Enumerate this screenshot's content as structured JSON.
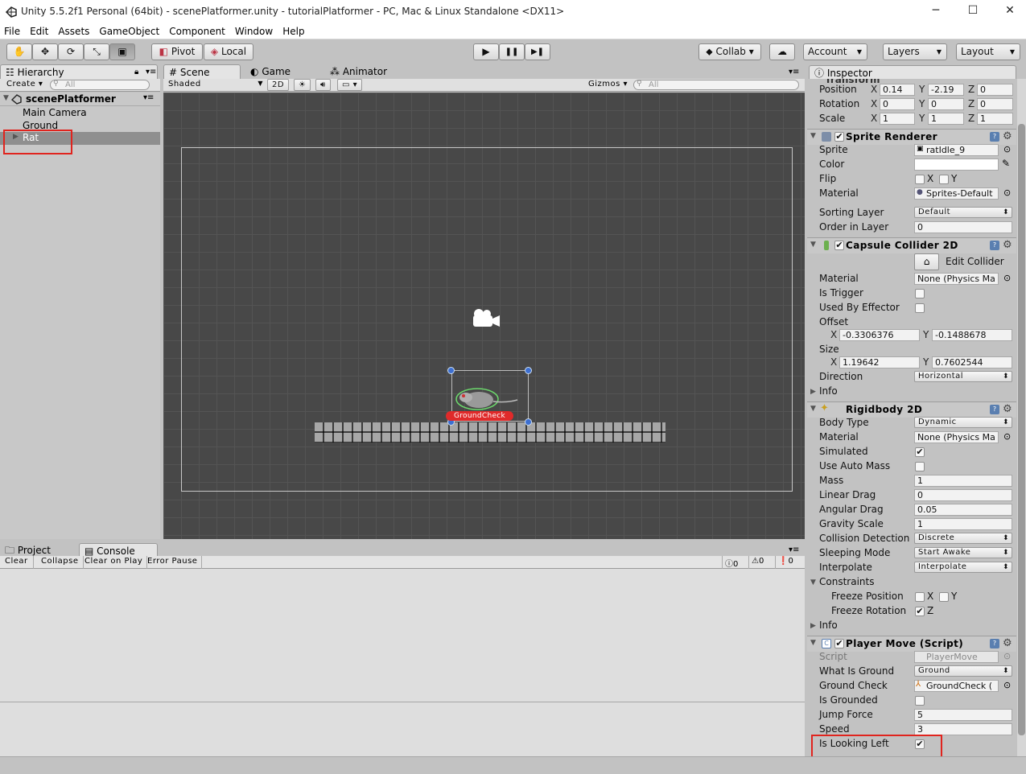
{
  "window": {
    "title": "Unity 5.5.2f1 Personal (64bit) - scenePlatformer.unity - tutorialPlatformer - PC, Mac & Linux Standalone <DX11>",
    "minimize": "─",
    "maximize": "☐",
    "close": "✕"
  },
  "menu": [
    "File",
    "Edit",
    "Assets",
    "GameObject",
    "Component",
    "Window",
    "Help"
  ],
  "toolbar": {
    "pivot": "Pivot",
    "local": "Local",
    "collab": "Collab ▾",
    "account": "Account",
    "layers": "Layers",
    "layout": "Layout",
    "play": "▶",
    "pause": "❚❚",
    "step": "▶❚"
  },
  "tabs": {
    "hierarchy": "Hierarchy",
    "scene": "Scene",
    "game": "Game",
    "animator": "Animator",
    "inspector": "Inspector",
    "project": "Project",
    "console": "Console"
  },
  "hierarchy": {
    "create": "Create ▾",
    "search_placeholder": "All",
    "scene": "scenePlatformer",
    "items": [
      "Main Camera",
      "Ground",
      "Rat"
    ],
    "selected": "Rat"
  },
  "scene_toolbar": {
    "shaded": "Shaded",
    "mode_2d": "2D",
    "gizmos": "Gizmos ▾",
    "search_placeholder": "All"
  },
  "scene": {
    "ground_check_label": "GroundCheck"
  },
  "console": {
    "clear": "Clear",
    "collapse": "Collapse",
    "clear_on_play": "Clear on Play",
    "error_pause": "Error Pause",
    "log_count": "0",
    "warn_count": "0",
    "error_count": "0"
  },
  "inspector": {
    "transform": {
      "title": "Transform",
      "position_label": "Position",
      "rotation_label": "Rotation",
      "scale_label": "Scale",
      "position": [
        "0.14",
        "-2.19",
        "0"
      ],
      "rotation": [
        "0",
        "0",
        "0"
      ],
      "scale": [
        "1",
        "1",
        "1"
      ],
      "x": "X",
      "y": "Y",
      "z": "Z"
    },
    "sprite_renderer": {
      "title": "Sprite Renderer",
      "enabled": "✔",
      "sprite_label": "Sprite",
      "sprite": "ratIdle_9",
      "color_label": "Color",
      "flip_label": "Flip",
      "flip_x": "X",
      "flip_y": "Y",
      "material_label": "Material",
      "material": "Sprites-Default",
      "sorting_layer_label": "Sorting Layer",
      "sorting_layer": "Default",
      "order_label": "Order in Layer",
      "order": "0"
    },
    "capsule_collider": {
      "title": "Capsule Collider 2D",
      "enabled": "✔",
      "edit_collider": "Edit Collider",
      "material_label": "Material",
      "material": "None (Physics Ma",
      "is_trigger_label": "Is Trigger",
      "used_by_effector_label": "Used By Effector",
      "offset_label": "Offset",
      "offset": [
        "-0.3306376",
        "-0.1488678"
      ],
      "size_label": "Size",
      "size": [
        "1.19642",
        "0.7602544"
      ],
      "direction_label": "Direction",
      "direction": "Horizontal",
      "info_label": "Info",
      "x": "X",
      "y": "Y"
    },
    "rigidbody": {
      "title": "Rigidbody 2D",
      "body_type_label": "Body Type",
      "body_type": "Dynamic",
      "material_label": "Material",
      "material": "None (Physics Ma",
      "simulated_label": "Simulated",
      "simulated": "✔",
      "auto_mass_label": "Use Auto Mass",
      "mass_label": "Mass",
      "mass": "1",
      "linear_drag_label": "Linear Drag",
      "linear_drag": "0",
      "angular_drag_label": "Angular Drag",
      "angular_drag": "0.05",
      "gravity_label": "Gravity Scale",
      "gravity": "1",
      "collision_label": "Collision Detection",
      "collision": "Discrete",
      "sleeping_label": "Sleeping Mode",
      "sleeping": "Start Awake",
      "interpolate_label": "Interpolate",
      "interpolate": "Interpolate",
      "constraints_label": "Constraints",
      "freeze_pos_label": "Freeze Position",
      "freeze_rot_label": "Freeze Rotation",
      "freeze_rot_z": "✔",
      "info_label": "Info",
      "x": "X",
      "y": "Y",
      "z": "Z"
    },
    "player_move": {
      "title": "Player Move (Script)",
      "enabled": "✔",
      "script_label": "Script",
      "script": "PlayerMove",
      "ground_label": "What Is Ground",
      "ground": "Ground",
      "ground_check_label": "Ground Check",
      "ground_check": "GroundCheck (",
      "is_grounded_label": "Is Grounded",
      "jump_label": "Jump Force",
      "jump": "5",
      "speed_label": "Speed",
      "speed": "3",
      "looking_left_label": "Is Looking Left",
      "looking_left": "✔"
    }
  },
  "colors": {
    "highlight": "#e0241e",
    "selection": "#8f8f8f",
    "accent": "#3d6fd1"
  }
}
